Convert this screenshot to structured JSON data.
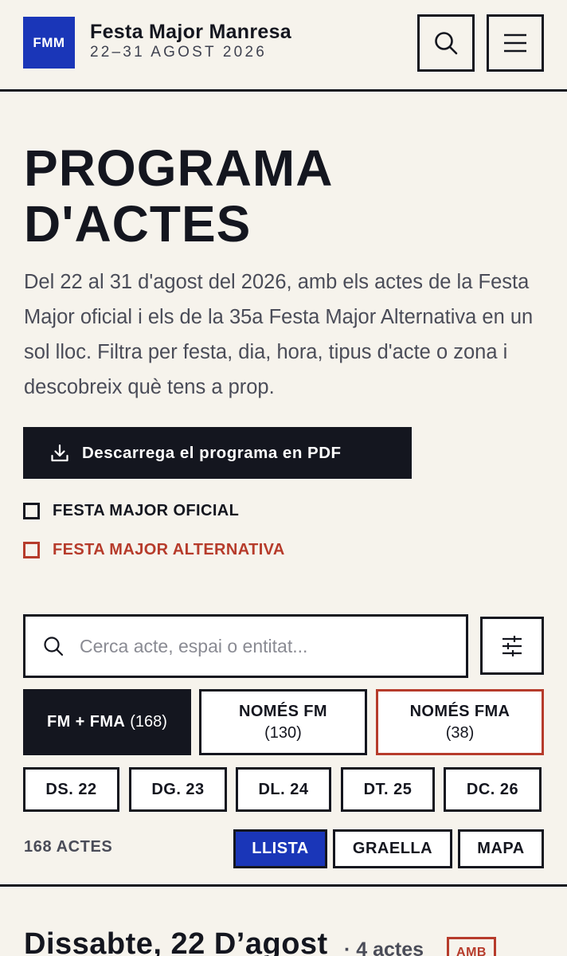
{
  "header": {
    "logo": "FMM",
    "title": "Festa Major Manresa",
    "dates": "22–31 AGOST 2026"
  },
  "hero": {
    "title_line1": "PROGRAMA",
    "title_line2": "D'ACTES",
    "intro": "Del 22 al 31 d'agost del 2026, amb els actes de la Festa Major oficial i els de la 35a Festa Major Alternativa en un sol lloc. Filtra per festa, dia, hora, tipus d'acte o zona i descobreix què tens a prop.",
    "pdf_button": "Descarrega el programa en PDF"
  },
  "legend": {
    "fm": "FESTA MAJOR OFICIAL",
    "fma": "FESTA MAJOR ALTERNATIVA",
    "fm_color": "#14161f",
    "fma_color": "#b63b2b"
  },
  "search": {
    "placeholder": "Cerca acte, espai o entitat...",
    "value": ""
  },
  "festa_filter": {
    "all_label": "FM + FMA",
    "all_count": "(168)",
    "fm_label": "NOMÉS FM",
    "fm_count": "(130)",
    "fma_label": "NOMÉS FMA",
    "fma_count": "(38)",
    "selected": "FM + FMA"
  },
  "days": [
    "DS. 22",
    "DG. 23",
    "DL. 24",
    "DT. 25",
    "DC. 26"
  ],
  "results": {
    "count": "168 ACTES"
  },
  "views": {
    "list": "LLISTA",
    "grid": "GRAELLA",
    "map": "MAPA",
    "active": "LLISTA"
  },
  "section": {
    "day_title": "Dissabte, 22 D’agost",
    "day_count": "· 4 actes",
    "tag": "AMB"
  },
  "colors": {
    "accent": "#1a36b8",
    "ink": "#14161f",
    "alt_red": "#b63b2b",
    "background": "#f6f3ec"
  }
}
